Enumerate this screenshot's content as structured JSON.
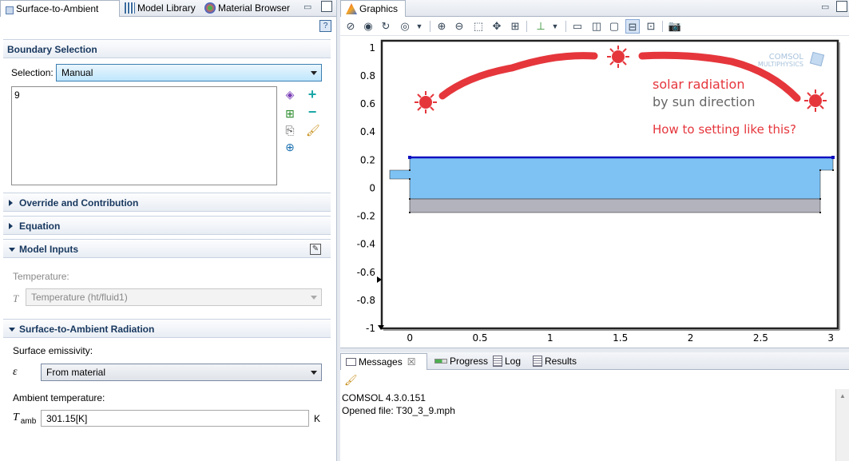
{
  "left_tabs": [
    {
      "label": "Surface-to-Ambient"
    },
    {
      "label": "Model Library"
    },
    {
      "label": "Material Browser"
    }
  ],
  "boundary": {
    "title": "Boundary Selection",
    "selection_label": "Selection:",
    "selection_value": "Manual",
    "list_items": [
      "9"
    ]
  },
  "sections": {
    "override": "Override and Contribution",
    "equation": "Equation",
    "model_inputs": "Model Inputs",
    "radiation": "Surface-to-Ambient Radiation"
  },
  "model_inputs": {
    "temp_label": "Temperature:",
    "temp_symbol": "T",
    "temp_value": "Temperature (ht/fluid1)"
  },
  "radiation": {
    "emissivity_label": "Surface emissivity:",
    "emissivity_symbol": "ε",
    "emissivity_value": "From material",
    "ambient_label": "Ambient temperature:",
    "ambient_symbol": "T",
    "ambient_subscript": "amb",
    "ambient_value": "301.15[K]",
    "ambient_unit": "K"
  },
  "graphics": {
    "tab_label": "Graphics",
    "watermark_line1": "COMSOL",
    "watermark_line2": "MULTIPHYSICS",
    "annotation_1": "solar radiation",
    "annotation_2": "by sun direction",
    "annotation_3": "How to setting like this?",
    "colors": {
      "domain_blue": "#7ec2f4",
      "domain_gray": "#b3b3bd",
      "boundary": "#1010c0",
      "annotation_red": "#e5363c"
    }
  },
  "chart_data": {
    "type": "scatter",
    "x_ticks": [
      "0",
      "0.5",
      "1",
      "1.5",
      "2",
      "2.5",
      "3"
    ],
    "y_ticks": [
      "1",
      "0.8",
      "0.6",
      "0.4",
      "0.2",
      "0",
      "-0.2",
      "-0.4",
      "-0.6",
      "-0.8",
      "-1"
    ],
    "xlim": [
      -0.2,
      3.05
    ],
    "ylim": [
      -1,
      1.05
    ]
  },
  "bottom_tabs": [
    {
      "label": "Messages"
    },
    {
      "label": "Progress"
    },
    {
      "label": "Log"
    },
    {
      "label": "Results"
    }
  ],
  "messages": [
    "COMSOL 4.3.0.151",
    "Opened file: T30_3_9.mph"
  ]
}
